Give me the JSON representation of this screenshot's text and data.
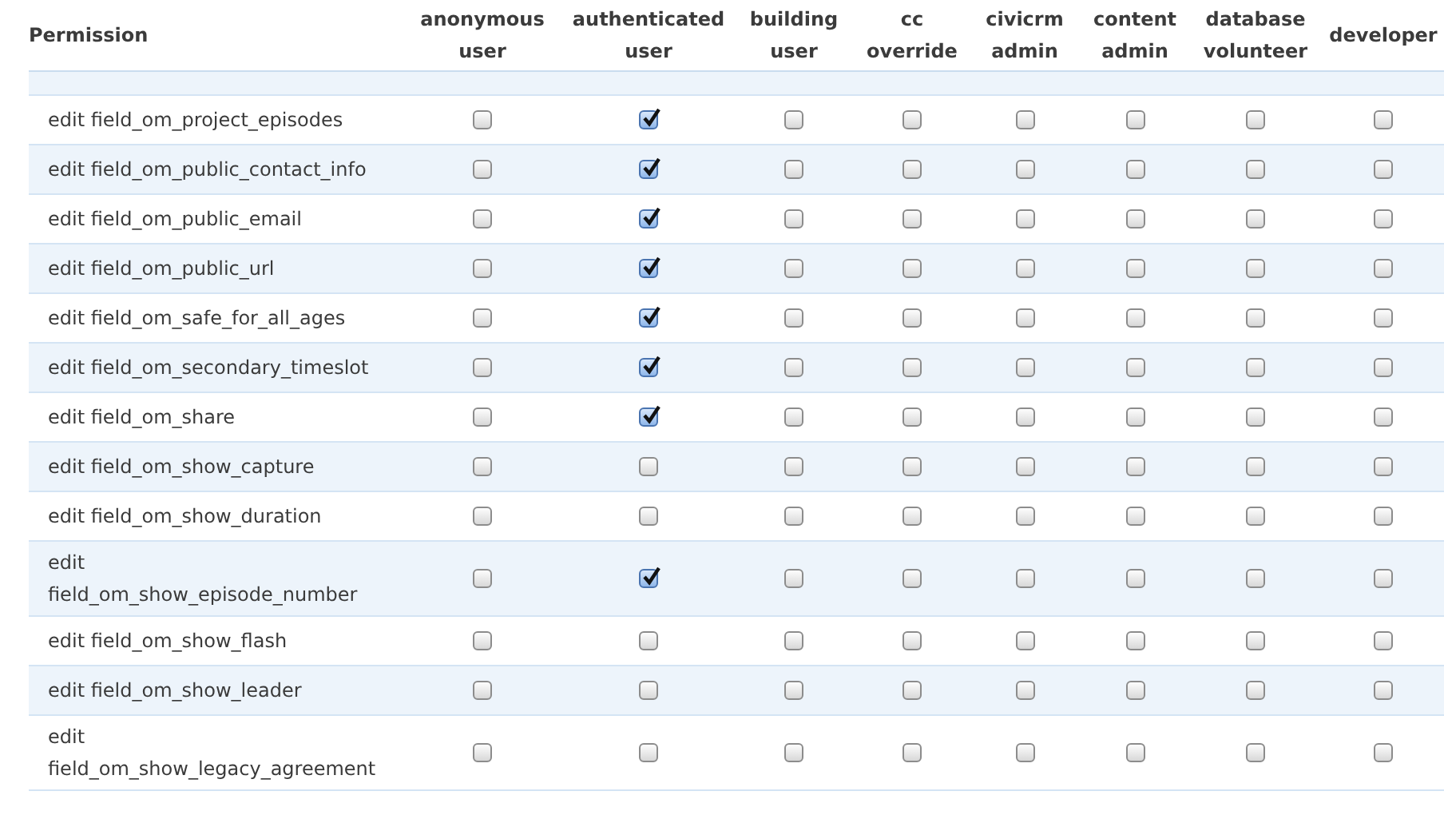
{
  "table": {
    "columns": [
      {
        "label": "Permission"
      },
      {
        "label": "anonymous user"
      },
      {
        "label": "authenticated user"
      },
      {
        "label": "building user"
      },
      {
        "label": "cc override"
      },
      {
        "label": "civicrm admin"
      },
      {
        "label": "content admin"
      },
      {
        "label": "database volunteer"
      },
      {
        "label": "developer"
      }
    ],
    "rows": [
      {
        "label": "edit field_om_project_episodes",
        "checked": [
          false,
          true,
          false,
          false,
          false,
          false,
          false,
          false
        ]
      },
      {
        "label": "edit field_om_public_contact_info",
        "checked": [
          false,
          true,
          false,
          false,
          false,
          false,
          false,
          false
        ]
      },
      {
        "label": "edit field_om_public_email",
        "checked": [
          false,
          true,
          false,
          false,
          false,
          false,
          false,
          false
        ]
      },
      {
        "label": "edit field_om_public_url",
        "checked": [
          false,
          true,
          false,
          false,
          false,
          false,
          false,
          false
        ]
      },
      {
        "label": "edit field_om_safe_for_all_ages",
        "checked": [
          false,
          true,
          false,
          false,
          false,
          false,
          false,
          false
        ]
      },
      {
        "label": "edit field_om_secondary_timeslot",
        "checked": [
          false,
          true,
          false,
          false,
          false,
          false,
          false,
          false
        ]
      },
      {
        "label": "edit field_om_share",
        "checked": [
          false,
          true,
          false,
          false,
          false,
          false,
          false,
          false
        ]
      },
      {
        "label": "edit field_om_show_capture",
        "checked": [
          false,
          false,
          false,
          false,
          false,
          false,
          false,
          false
        ]
      },
      {
        "label": "edit field_om_show_duration",
        "checked": [
          false,
          false,
          false,
          false,
          false,
          false,
          false,
          false
        ]
      },
      {
        "label": "edit field_om_show_episode_number",
        "checked": [
          false,
          true,
          false,
          false,
          false,
          false,
          false,
          false
        ]
      },
      {
        "label": "edit field_om_show_flash",
        "checked": [
          false,
          false,
          false,
          false,
          false,
          false,
          false,
          false
        ]
      },
      {
        "label": "edit field_om_show_leader",
        "checked": [
          false,
          false,
          false,
          false,
          false,
          false,
          false,
          false
        ]
      },
      {
        "label": "edit field_om_show_legacy_agreement",
        "checked": [
          false,
          false,
          false,
          false,
          false,
          false,
          false,
          false
        ]
      }
    ]
  }
}
